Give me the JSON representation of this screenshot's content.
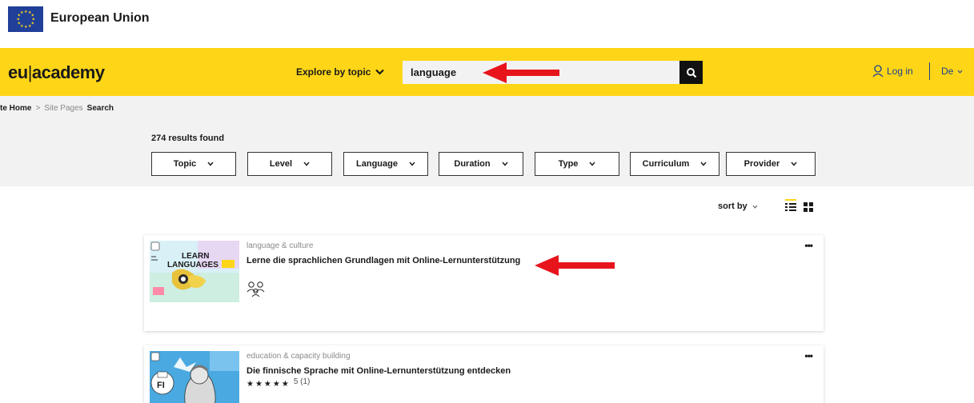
{
  "eu_strip": {
    "name": "European Union"
  },
  "header": {
    "logo_left": "eu",
    "logo_right": "academy",
    "explore_label": "Explore by topic",
    "search_value": "language",
    "login_label": "Log in",
    "language_label": "De"
  },
  "breadcrumb": {
    "home": "te Home",
    "section": "Site Pages",
    "current": "Search"
  },
  "results": {
    "count_label": "274 results found"
  },
  "filters": [
    "Topic",
    "Level",
    "Language",
    "Duration",
    "Type",
    "Curriculum",
    "Provider"
  ],
  "sort": {
    "label": "sort by"
  },
  "cards": [
    {
      "topic": "language & culture",
      "title": "Lerne die sprachlichen Grundlagen mit Online-Lernunterstützung",
      "thumb_text_1": "LEARN",
      "thumb_text_2": "LANGUAGES"
    },
    {
      "topic": "education & capacity building",
      "title": "Die finnische Sprache mit Online-Lernunterstützung entdecken",
      "stars": "★★★★★",
      "rating": "5 (1)",
      "thumb_text_1": "FI"
    }
  ],
  "colors": {
    "header_yellow": "#ffd617",
    "eu_blue": "#1f3f99",
    "link_blue": "#1a3e8f",
    "arrow_red": "#e8141c"
  }
}
